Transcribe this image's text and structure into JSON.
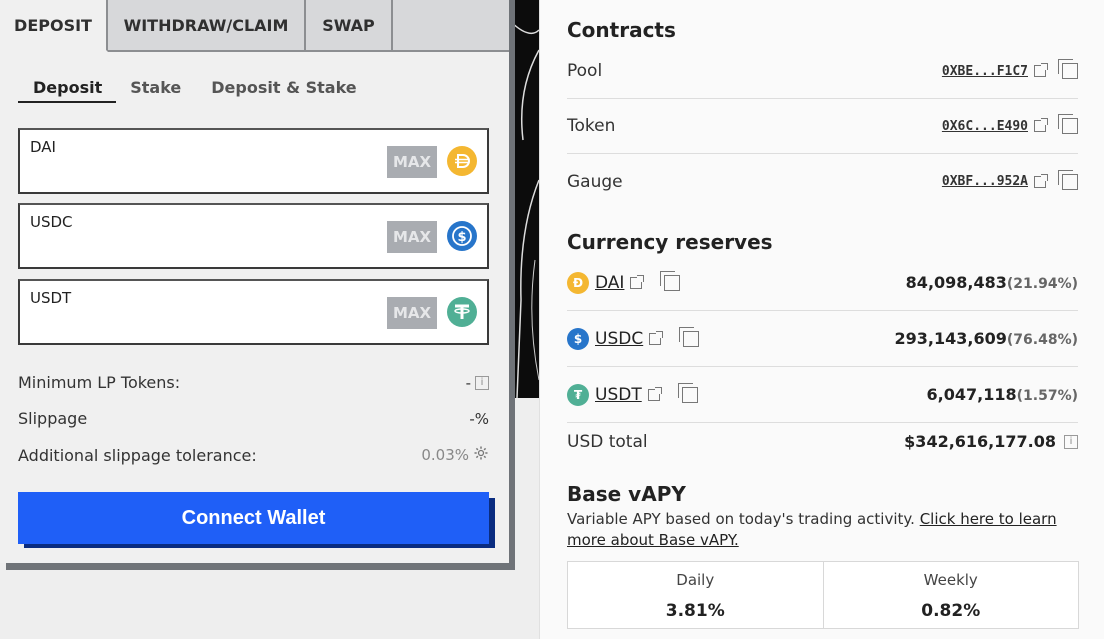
{
  "tabs": [
    "DEPOSIT",
    "WITHDRAW/CLAIM",
    "SWAP"
  ],
  "subtabs": [
    "Deposit",
    "Stake",
    "Deposit & Stake"
  ],
  "fields": [
    {
      "label": "DAI",
      "max": "MAX",
      "icon": "dai-icon",
      "color": "#f4b731"
    },
    {
      "label": "USDC",
      "max": "MAX",
      "icon": "usdc-icon",
      "color": "#2775ca"
    },
    {
      "label": "USDT",
      "max": "MAX",
      "icon": "usdt-icon",
      "color": "#50af95"
    }
  ],
  "info": {
    "min_lp_label": "Minimum LP Tokens:",
    "min_lp_value": "-",
    "slippage_label": "Slippage",
    "slippage_value": "-%",
    "tolerance_label": "Additional slippage tolerance:",
    "tolerance_value": "0.03%"
  },
  "connect_label": "Connect Wallet",
  "contracts": {
    "heading": "Contracts",
    "rows": [
      {
        "label": "Pool",
        "address": "0XBE...F1C7"
      },
      {
        "label": "Token",
        "address": "0X6C...E490"
      },
      {
        "label": "Gauge",
        "address": "0XBF...952A"
      }
    ]
  },
  "reserves": {
    "heading": "Currency reserves",
    "rows": [
      {
        "name": "DAI",
        "amount": "84,098,483",
        "pct": "(21.94%)",
        "color": "#f4b731"
      },
      {
        "name": "USDC",
        "amount": "293,143,609",
        "pct": "(76.48%)",
        "color": "#2775ca"
      },
      {
        "name": "USDT",
        "amount": "6,047,118",
        "pct": "(1.57%)",
        "color": "#50af95"
      }
    ],
    "total_label": "USD total",
    "total_value": "$342,616,177.08"
  },
  "vapy": {
    "heading": "Base vAPY",
    "desc": "Variable APY based on today's trading activity. ",
    "link": "Click here to learn more about Base vAPY.",
    "daily_label": "Daily",
    "daily_value": "3.81%",
    "weekly_label": "Weekly",
    "weekly_value": "0.82%"
  }
}
